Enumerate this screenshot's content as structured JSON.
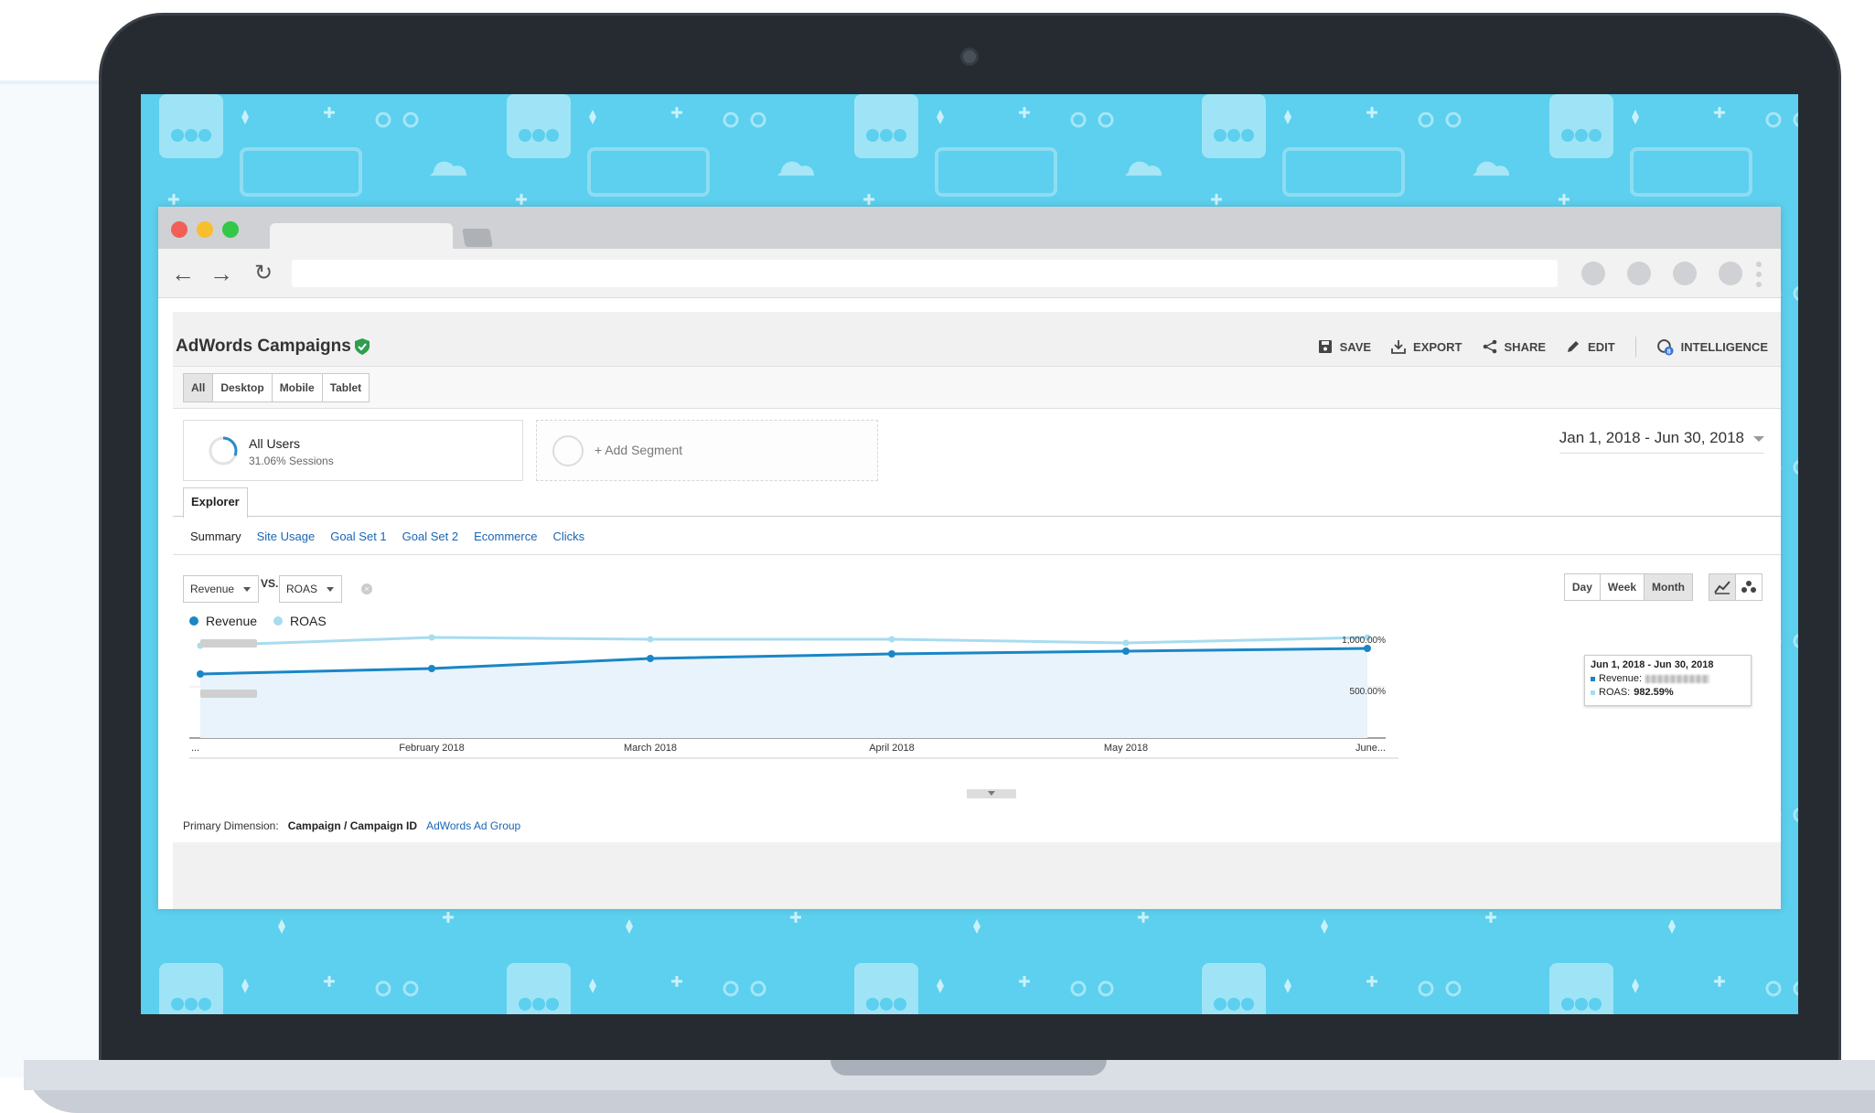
{
  "report": {
    "title": "AdWords Campaigns",
    "actions": [
      {
        "label": "SAVE",
        "icon": "save-icon"
      },
      {
        "label": "EXPORT",
        "icon": "export-icon"
      },
      {
        "label": "SHARE",
        "icon": "share-icon"
      },
      {
        "label": "EDIT",
        "icon": "edit-icon"
      },
      {
        "label": "INTELLIGENCE",
        "icon": "intelligence-icon",
        "badge": "8"
      }
    ]
  },
  "devices": [
    "All",
    "Desktop",
    "Mobile",
    "Tablet"
  ],
  "devices_active": "All",
  "segment": {
    "name": "All Users",
    "sub": "31.06% Sessions",
    "add_label": "+ Add Segment"
  },
  "date_range": "Jan 1, 2018 - Jun 30, 2018",
  "explorer_tab": "Explorer",
  "subtabs": [
    "Summary",
    "Site Usage",
    "Goal Set 1",
    "Goal Set 2",
    "Ecommerce",
    "Clicks"
  ],
  "subtabs_active": "Summary",
  "metric1": "Revenue",
  "vs_label": "VS.",
  "metric2": "ROAS",
  "periods": [
    "Day",
    "Week",
    "Month"
  ],
  "period_active": "Month",
  "colors": {
    "revenue": "#1a86c6",
    "roas": "#a8dcf0",
    "area": "#e8f3fb",
    "screen_bg": "#5cd0ee"
  },
  "chart_data": {
    "type": "line",
    "x": [
      "...",
      "February 2018",
      "March 2018",
      "April 2018",
      "May 2018",
      "June..."
    ],
    "series": [
      {
        "name": "Revenue",
        "values": [
          null,
          null,
          null,
          null,
          null,
          null
        ]
      },
      {
        "name": "ROAS",
        "values": [
          null,
          null,
          null,
          null,
          null,
          982.59
        ]
      }
    ],
    "right_axis_ticks": [
      "1,000.00%",
      "500.00%"
    ],
    "tooltip": {
      "title": "Jun 1, 2018 - Jun 30, 2018",
      "revenue_label": "Revenue:",
      "roas_label": "ROAS:",
      "roas_value": "982.59%"
    }
  },
  "primary_dimension": {
    "label": "Primary Dimension:",
    "active": "Campaign / Campaign ID",
    "link": "AdWords Ad Group"
  }
}
